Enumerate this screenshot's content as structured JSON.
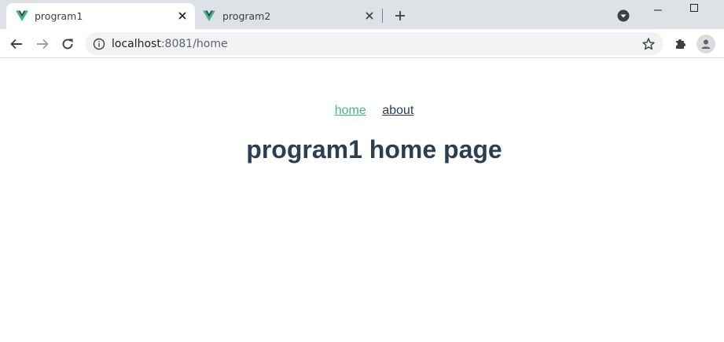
{
  "browser": {
    "tabs": [
      {
        "title": "program1",
        "active": true,
        "icon": "vue-logo-icon"
      },
      {
        "title": "program2",
        "active": false,
        "icon": "vue-logo-icon"
      }
    ],
    "address_bar": {
      "host": "localhost",
      "rest": ":8081/home"
    }
  },
  "page": {
    "nav": {
      "home_label": "home",
      "about_label": "about"
    },
    "heading": "program1 home page"
  },
  "colors": {
    "tabstrip": "#dee1e6",
    "link_active": "#42b983",
    "text_dark": "#2c3e50",
    "vue_green": "#41b883",
    "vue_dark": "#34495e"
  }
}
